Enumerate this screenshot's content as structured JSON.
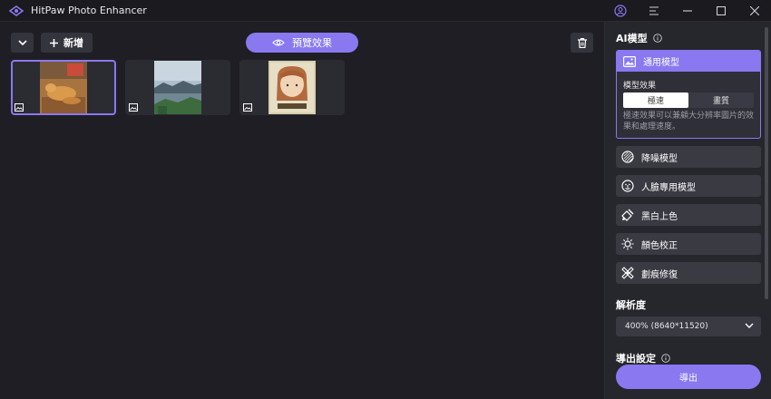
{
  "app": {
    "title": "HitPaw Photo Enhancer"
  },
  "toolbar": {
    "add_label": "新增",
    "preview_label": "預覽效果"
  },
  "thumbnails": [
    {
      "name": "thumb-dog",
      "selected": true
    },
    {
      "name": "thumb-landscape",
      "selected": false
    },
    {
      "name": "thumb-portrait",
      "selected": false
    }
  ],
  "panel": {
    "ai_model_title": "AI模型",
    "general_model": {
      "label": "通用模型",
      "effect_label": "模型效果",
      "options": [
        "極速",
        "畫質"
      ],
      "selected": "極速",
      "description": "極速效果可以兼顧大分辨率圖片的效果和處理速度。"
    },
    "models": [
      "降噪模型",
      "人臉專用模型",
      "黑白上色",
      "顏色校正",
      "劃痕修復"
    ],
    "resolution_title": "解析度",
    "resolution_value": "400% (8640*11520)",
    "output_title": "導出設定",
    "export_label": "導出"
  },
  "colors": {
    "accent": "#8a78f0",
    "bg": "#1e1e24",
    "panel": "#26262d"
  }
}
